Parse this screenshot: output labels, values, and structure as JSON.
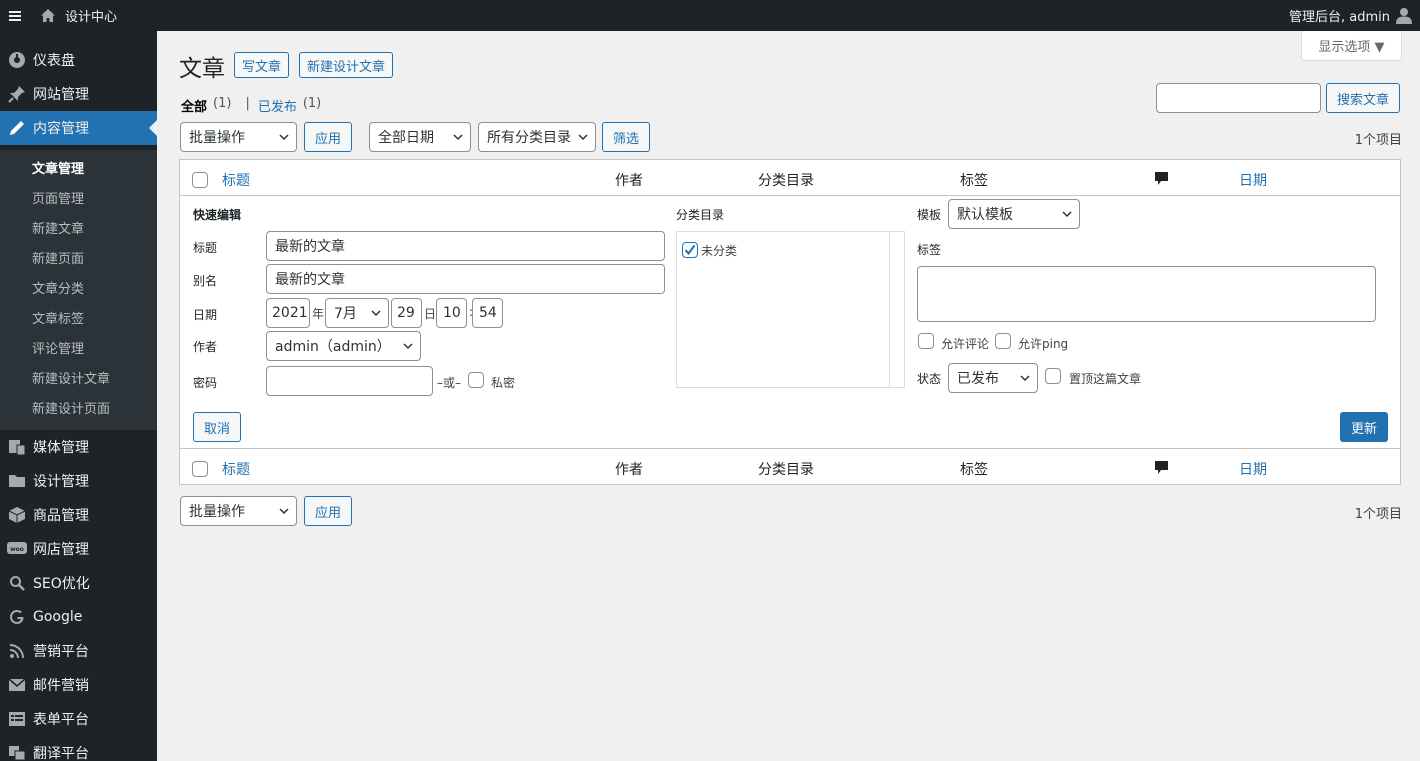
{
  "adminbar": {
    "menu_icon": "hamburger-icon",
    "home_icon": "home-icon",
    "site_name": "设计中心",
    "greeting": "管理后台, admin",
    "user_icon": "user-icon"
  },
  "sidebar": {
    "items": [
      {
        "label": "仪表盘",
        "icon": "dashboard-icon"
      },
      {
        "label": "网站管理",
        "icon": "pin-icon"
      },
      {
        "label": "内容管理",
        "icon": "edit-icon"
      },
      {
        "label": "媒体管理",
        "icon": "media-icon"
      },
      {
        "label": "设计管理",
        "icon": "folder-icon"
      },
      {
        "label": "商品管理",
        "icon": "box-icon"
      },
      {
        "label": "网店管理",
        "icon": "woo-icon"
      },
      {
        "label": "SEO优化",
        "icon": "search-icon"
      },
      {
        "label": "Google",
        "icon": "google-icon"
      },
      {
        "label": "营销平台",
        "icon": "rss-icon"
      },
      {
        "label": "邮件营销",
        "icon": "mail-icon"
      },
      {
        "label": "表单平台",
        "icon": "form-icon"
      },
      {
        "label": "翻译平台",
        "icon": "translate-icon"
      }
    ],
    "submenu": [
      "文章管理",
      "页面管理",
      "新建文章",
      "新建页面",
      "文章分类",
      "文章标签",
      "评论管理",
      "新建设计文章",
      "新建设计页面"
    ]
  },
  "header": {
    "screen_options": "显示选项 ▼",
    "title": "文章",
    "add_post": "写文章",
    "add_design_post": "新建设计文章"
  },
  "filters": {
    "all_label": "全部",
    "all_count": "(1)",
    "separator": "|",
    "published_label": "已发布",
    "published_count": "(1)",
    "search_value": "",
    "search_button": "搜索文章",
    "bulk_actions": "批量操作",
    "apply": "应用",
    "all_dates": "全部日期",
    "all_categories": "所有分类目录",
    "filter": "筛选",
    "items_count": "1个项目"
  },
  "table": {
    "columns": {
      "title": "标题",
      "author": "作者",
      "categories": "分类目录",
      "tags": "标签",
      "comments_icon": "comment-icon",
      "date": "日期"
    }
  },
  "quick_edit": {
    "heading": "快速编辑",
    "title_label": "标题",
    "title_value": "最新的文章",
    "slug_label": "别名",
    "slug_value": "最新的文章",
    "date_label": "日期",
    "year": "2021",
    "year_suffix": "年",
    "month": "7月",
    "day": "29",
    "day_suffix": "日",
    "hour": "10",
    "time_sep": ":",
    "minute": "54",
    "author_label": "作者",
    "author_value": "admin（admin）",
    "password_label": "密码",
    "password_value": "",
    "or_label": "–或–",
    "private_label": "私密",
    "categories_label": "分类目录",
    "category_item": "未分类",
    "template_label": "模板",
    "template_value": "默认模板",
    "tags_label": "标签",
    "allow_comments": "允许评论",
    "allow_ping": "允许ping",
    "status_label": "状态",
    "status_value": "已发布",
    "sticky_label": "置顶这篇文章",
    "cancel": "取消",
    "update": "更新"
  },
  "colors": {
    "accent": "#2271b1",
    "sidebar_bg": "#1d2327",
    "submenu_bg": "#2c3338",
    "page_bg": "#f0f0f1"
  }
}
